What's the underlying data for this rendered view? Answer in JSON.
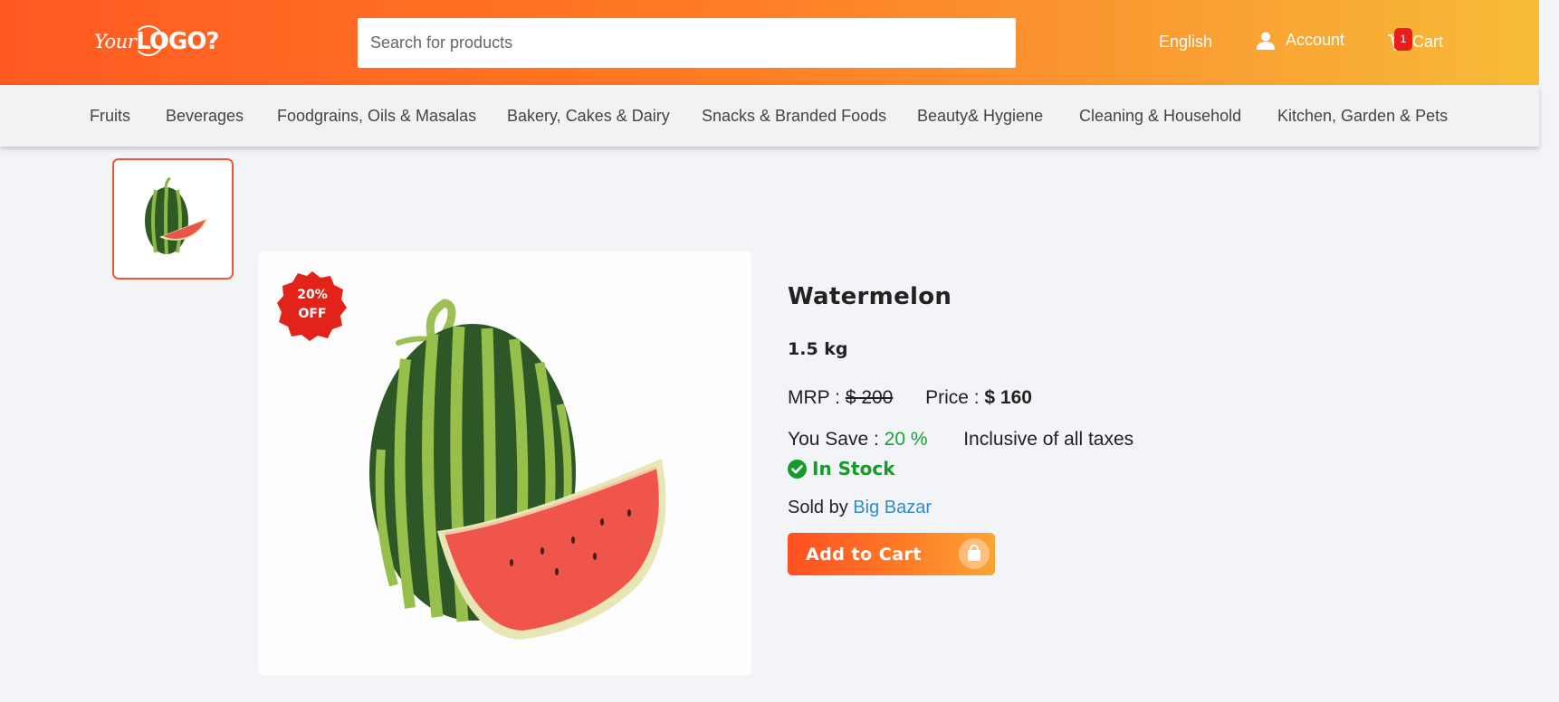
{
  "header": {
    "logo_text_your": "Your",
    "logo_text_logo": "LOGO?",
    "search_placeholder": "Search for products",
    "language": "English",
    "account_label": "Account",
    "cart_label": "Cart",
    "cart_count": "1"
  },
  "nav": {
    "items": [
      "Fruits",
      "Beverages",
      "Foodgrains, Oils & Masalas",
      "Bakery, Cakes & Dairy",
      "Snacks & Branded Foods",
      "Beauty& Hygiene",
      "Cleaning & Household",
      "Kitchen, Garden & Pets"
    ]
  },
  "product": {
    "discount_line1": "20%",
    "discount_line2": "OFF",
    "title": "Watermelon",
    "weight": "1.5 kg",
    "mrp_label": "MRP :",
    "mrp_value": "$ 200",
    "price_label": "Price :",
    "price_value": "$ 160",
    "save_label": "You Save :",
    "save_value": "20 %",
    "tax_note": "Inclusive of all taxes",
    "stock_status": "In Stock",
    "sold_by_label": "Sold by",
    "seller": "Big Bazar",
    "add_to_cart_label": "Add to Cart"
  },
  "icons": {
    "user": "user-icon",
    "cart": "cart-icon",
    "check": "check-circle-icon",
    "bag": "shopping-bag-icon"
  },
  "colors": {
    "header_gradient_start": "#ff5a22",
    "header_gradient_end": "#f7bc37",
    "badge": "#ea1c1c",
    "discount_badge": "#e2231a",
    "in_stock": "#159b2a",
    "save_percent": "#1aa036",
    "seller_link": "#2d8ccc",
    "thumb_border": "#ec5a33"
  }
}
